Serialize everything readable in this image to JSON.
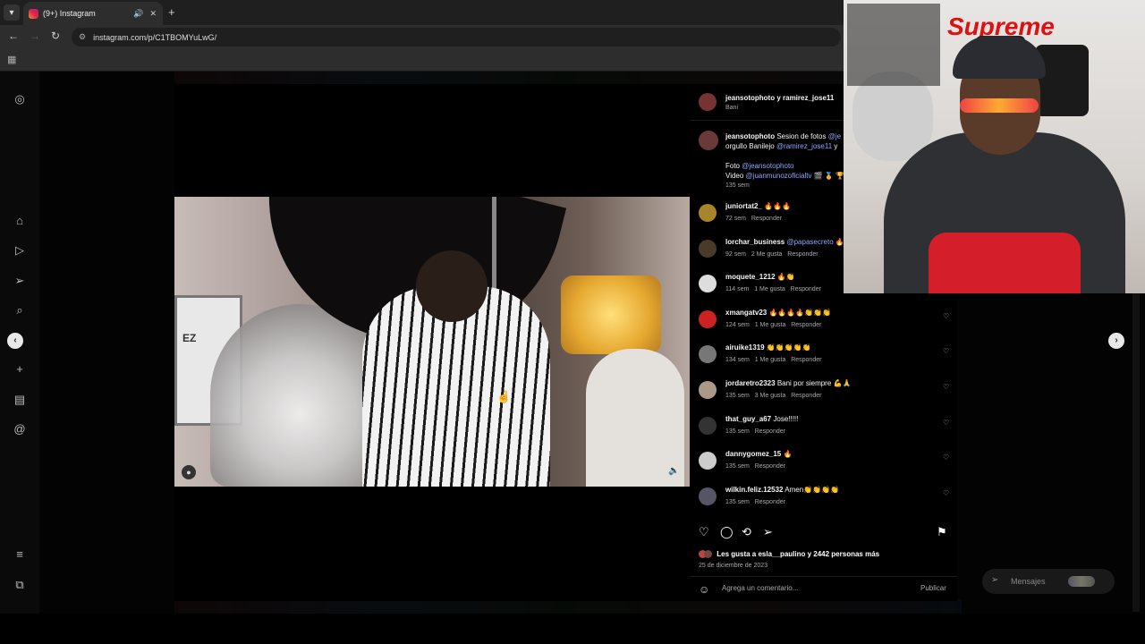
{
  "browser": {
    "tab_title": "(9+) Instagram",
    "url": "instagram.com/p/C1TBOMYuLwG/"
  },
  "post": {
    "header_user": "jeansotophoto y ramirez_jose11",
    "header_sub": "Bani",
    "caption": {
      "user": "jeansotophoto",
      "line1": " Sesion de fotos ",
      "mention1": "@je",
      "line2": "orgullo Banilejo ",
      "mention2": "@ramirez_jose11",
      "line2_end": " y",
      "line3": "Foto ",
      "mention3": "@jeansotophoto",
      "line4": "Video ",
      "mention4": "@juanmunozoficialtv",
      "line4_end": " 🎬 🏅 🏆",
      "time": "135 sem"
    },
    "comments": [
      {
        "user": "juniortat2_",
        "text": " 🔥🔥🔥",
        "time": "72 sem",
        "likes": "",
        "reply": "Responder"
      },
      {
        "user": "lorchar_business",
        "mention": "@papasecreto",
        "text": " 🔥",
        "time": "92 sem",
        "likes": "2 Me gusta",
        "reply": "Responder"
      },
      {
        "user": "moquete_1212",
        "text": " 🔥👏",
        "time": "114 sem",
        "likes": "1 Me gusta",
        "reply": "Responder"
      },
      {
        "user": "xmangatv23",
        "text": " 🔥🔥🔥🔥👏👏👏",
        "time": "124 sem",
        "likes": "1 Me gusta",
        "reply": "Responder"
      },
      {
        "user": "airuike1319",
        "text": " 👏👏👏👏👏",
        "time": "134 sem",
        "likes": "1 Me gusta",
        "reply": "Responder"
      },
      {
        "user": "jordaretro2323",
        "text": " Bani por siempre 💪🙏",
        "time": "135 sem",
        "likes": "3 Me gusta",
        "reply": "Responder"
      },
      {
        "user": "that_guy_a67",
        "text": " Jose!!!!!",
        "time": "135 sem",
        "likes": "",
        "reply": "Responder"
      },
      {
        "user": "dannygomez_15",
        "text": " 🔥",
        "time": "135 sem",
        "likes": "",
        "reply": "Responder"
      },
      {
        "user": "wilkin.feliz.12532",
        "text": " Amen👏👏👏👏",
        "time": "135 sem",
        "likes": "",
        "reply": "Responder"
      }
    ],
    "likes_text": "Les gusta a esla__paulino y 2442 personas más",
    "date": "25 de diciembre de 2023",
    "comment_placeholder": "Agrega un comentario...",
    "publish_label": "Publicar"
  },
  "messages": {
    "label": "Mensajes"
  },
  "webcam": {
    "brand": "Supreme"
  },
  "video_overlay": {
    "poster_text": "EZ"
  },
  "icons": {
    "heart": "heart-icon",
    "comment": "comment-icon",
    "repost": "repost-icon",
    "share": "share-icon",
    "save": "bookmark-icon",
    "emoji": "emoji-icon"
  },
  "colors": {
    "link": "#8fa6ff",
    "webcam_brand": "#dd1111"
  }
}
